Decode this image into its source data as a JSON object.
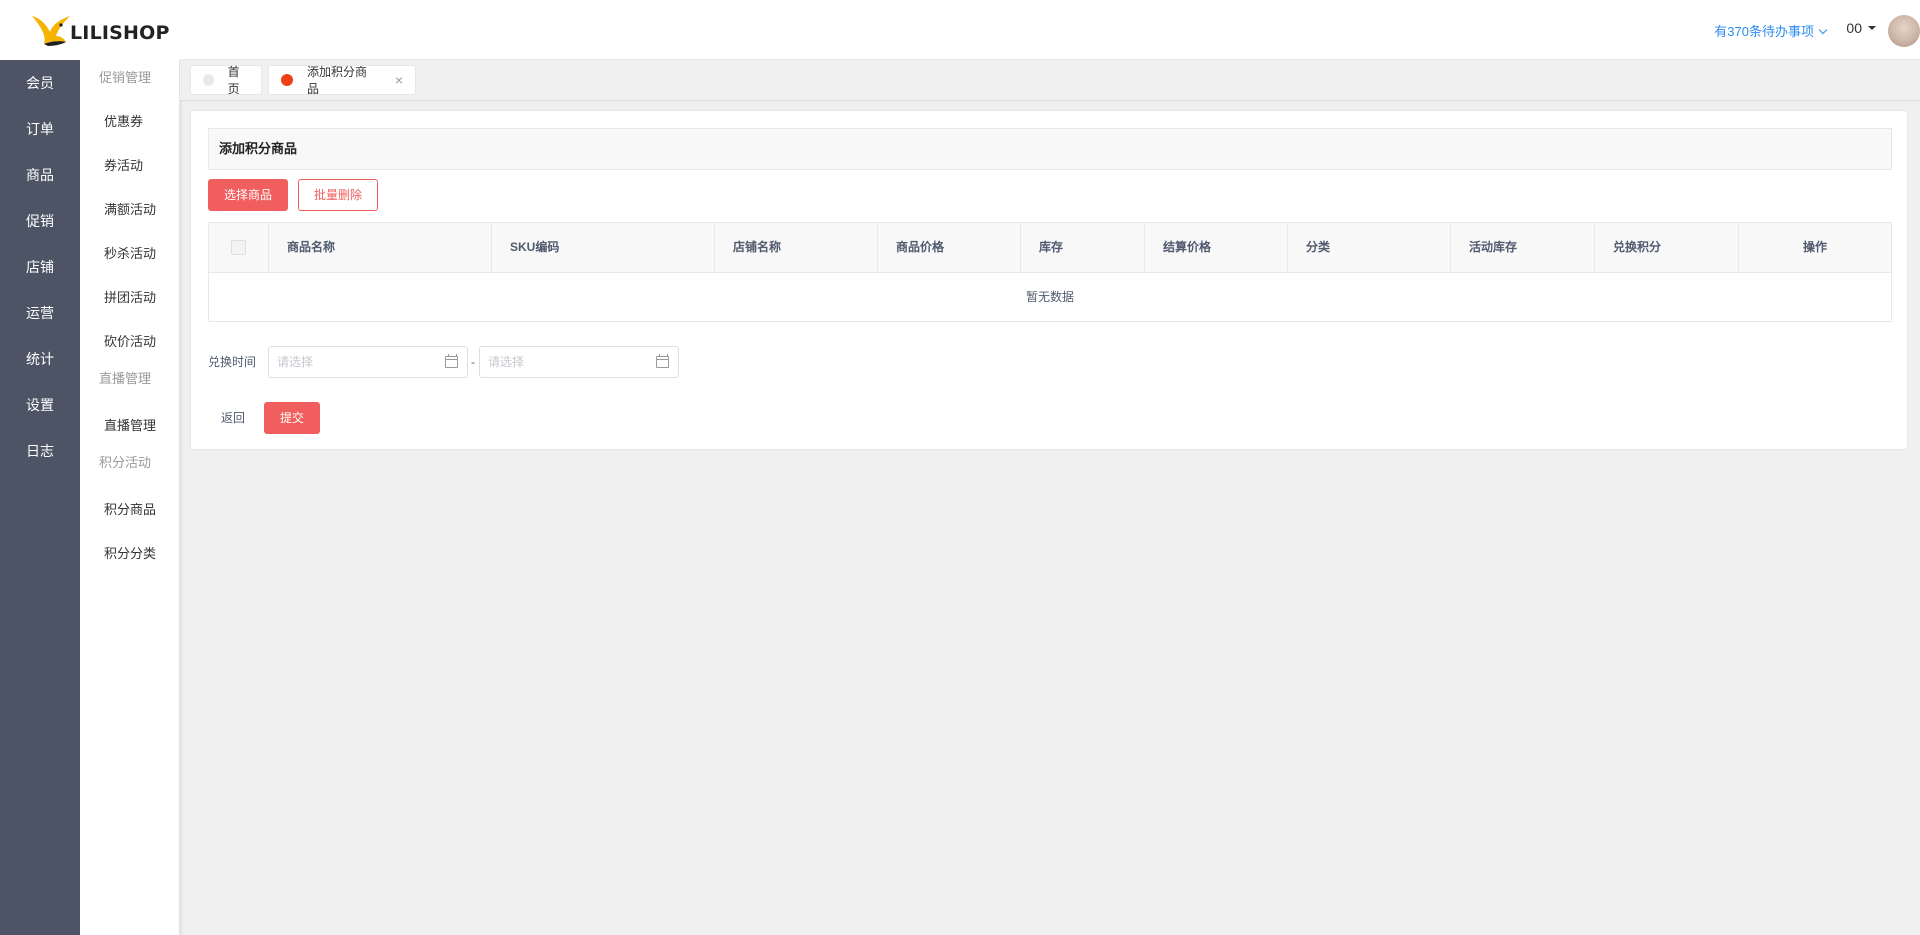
{
  "brand": {
    "logo_text": "LILISHOP"
  },
  "main_nav": [
    "会员",
    "订单",
    "商品",
    "促销",
    "店铺",
    "运营",
    "统计",
    "设置",
    "日志"
  ],
  "sub_nav": {
    "group_promo": "促销管理",
    "promo_items": [
      "优惠券",
      "券活动",
      "满额活动",
      "秒杀活动",
      "拼团活动",
      "砍价活动"
    ],
    "group_live": "直播管理",
    "live_items": [
      "直播管理"
    ],
    "group_points": "积分活动",
    "points_items": [
      "积分商品",
      "积分分类"
    ]
  },
  "header": {
    "todo_text": "有370条待办事项",
    "username": "00"
  },
  "tabs": [
    {
      "label": "首页"
    },
    {
      "label": "添加积分商品"
    }
  ],
  "page": {
    "title": "添加积分商品",
    "select_goods_label": "选择商品",
    "batch_delete_label": "批量删除",
    "columns": [
      "商品名称",
      "SKU编码",
      "店铺名称",
      "商品价格",
      "库存",
      "结算价格",
      "分类",
      "活动库存",
      "兑换积分",
      "操作"
    ],
    "empty_text": "暂无数据",
    "exchange_time_label": "兑换时间",
    "date_start_placeholder": "请选择",
    "date_end_placeholder": "请选择",
    "date_separator": "-",
    "back_label": "返回",
    "submit_label": "提交"
  },
  "colors": {
    "nav_bg": "#4c5465",
    "accent": "#f15e5e",
    "link": "#2d8cf0"
  }
}
